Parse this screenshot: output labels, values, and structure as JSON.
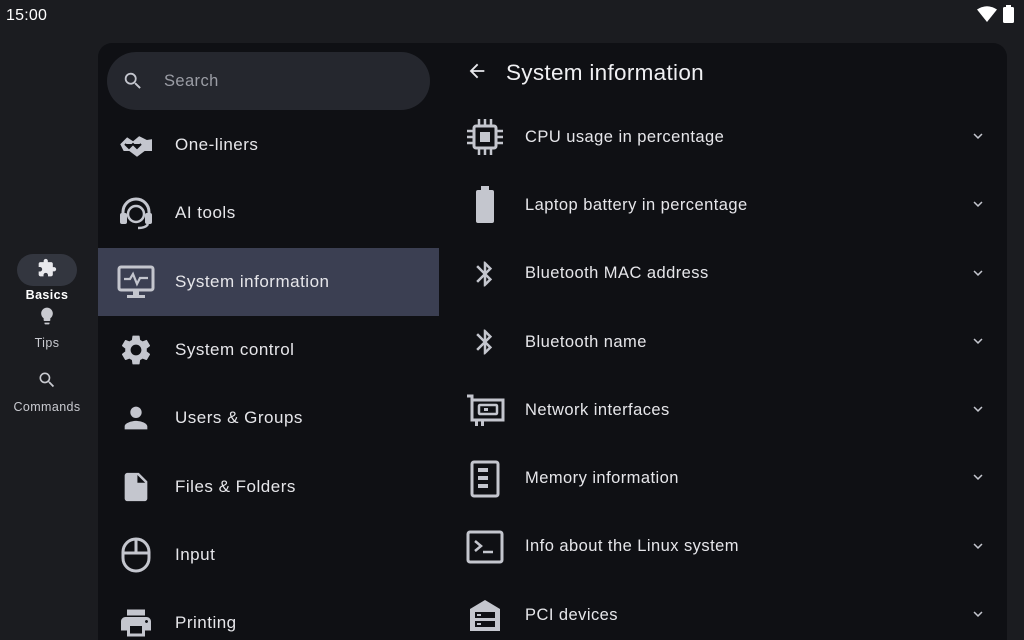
{
  "status": {
    "time": "15:00",
    "wifi_icon": "wifi-icon",
    "battery_icon": "battery-full-icon"
  },
  "rail": {
    "items": [
      {
        "label": "Basics",
        "icon": "puzzle-icon",
        "active": true
      },
      {
        "label": "Tips",
        "icon": "lightbulb-icon",
        "active": false
      },
      {
        "label": "Commands",
        "icon": "search-icon",
        "active": false
      }
    ]
  },
  "search": {
    "placeholder": "Search",
    "value": ""
  },
  "categories": [
    {
      "label": "One-liners",
      "icon": "handshake-icon"
    },
    {
      "label": "AI tools",
      "icon": "headset-icon"
    },
    {
      "label": "System information",
      "icon": "monitor-heartbeat-icon",
      "active": true
    },
    {
      "label": "System control",
      "icon": "gear-icon"
    },
    {
      "label": "Users & Groups",
      "icon": "person-icon"
    },
    {
      "label": "Files & Folders",
      "icon": "file-icon"
    },
    {
      "label": "Input",
      "icon": "mouse-icon"
    },
    {
      "label": "Printing",
      "icon": "printer-icon"
    }
  ],
  "detail": {
    "title": "System information",
    "back_icon": "arrow-back-icon",
    "commands": [
      {
        "label": "CPU usage in percentage",
        "icon": "cpu-chip-icon"
      },
      {
        "label": "Laptop battery in percentage",
        "icon": "battery-icon"
      },
      {
        "label": "Bluetooth MAC address",
        "icon": "bluetooth-icon"
      },
      {
        "label": "Bluetooth name",
        "icon": "bluetooth-icon"
      },
      {
        "label": "Network interfaces",
        "icon": "network-card-icon"
      },
      {
        "label": "Memory information",
        "icon": "memory-icon"
      },
      {
        "label": "Info about the Linux system",
        "icon": "terminal-icon"
      },
      {
        "label": "PCI devices",
        "icon": "server-icon"
      }
    ]
  },
  "colors": {
    "panel": "#0f1014",
    "background": "#1b1c20",
    "active_item": "#3b3f52",
    "icon": "#c4c6ce"
  }
}
